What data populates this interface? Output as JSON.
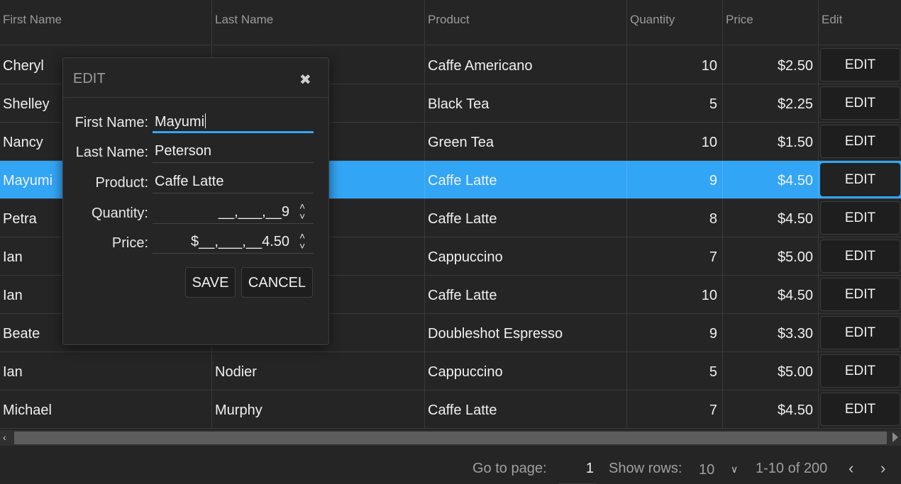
{
  "columns": [
    {
      "label": "First Name"
    },
    {
      "label": "Last Name"
    },
    {
      "label": "Product"
    },
    {
      "label": "Quantity"
    },
    {
      "label": "Price"
    },
    {
      "label": "Edit"
    }
  ],
  "rows": [
    {
      "first": "Cheryl",
      "last": "",
      "product": "Caffe Americano",
      "quantity": "10",
      "price": "$2.50",
      "edit": "EDIT"
    },
    {
      "first": "Shelley",
      "last": "",
      "product": "Black Tea",
      "quantity": "5",
      "price": "$2.25",
      "edit": "EDIT"
    },
    {
      "first": "Nancy",
      "last": "",
      "product": "Green Tea",
      "quantity": "10",
      "price": "$1.50",
      "edit": "EDIT"
    },
    {
      "first": "Mayumi",
      "last": "",
      "product": "Caffe Latte",
      "quantity": "9",
      "price": "$4.50",
      "edit": "EDIT"
    },
    {
      "first": "Petra",
      "last": "",
      "product": "Caffe Latte",
      "quantity": "8",
      "price": "$4.50",
      "edit": "EDIT"
    },
    {
      "first": "Ian",
      "last": "",
      "product": "Cappuccino",
      "quantity": "7",
      "price": "$5.00",
      "edit": "EDIT"
    },
    {
      "first": "Ian",
      "last": "",
      "product": "Caffe Latte",
      "quantity": "10",
      "price": "$4.50",
      "edit": "EDIT"
    },
    {
      "first": "Beate",
      "last": "",
      "product": "Doubleshot Espresso",
      "quantity": "9",
      "price": "$3.30",
      "edit": "EDIT"
    },
    {
      "first": "Ian",
      "last": "Nodier",
      "product": "Cappuccino",
      "quantity": "5",
      "price": "$5.00",
      "edit": "EDIT"
    },
    {
      "first": "Michael",
      "last": "Murphy",
      "product": "Caffe Latte",
      "quantity": "7",
      "price": "$4.50",
      "edit": "EDIT"
    }
  ],
  "selected_row_index": 3,
  "colors": {
    "selection": "#33a5f5",
    "background": "#252525"
  },
  "pager": {
    "go_to_label": "Go to page:",
    "page_value": "1",
    "show_rows_label": "Show rows:",
    "rows_value": "10",
    "range_text": "1-10 of 200"
  },
  "dialog": {
    "title": "EDIT",
    "fields": {
      "first_name": {
        "label": "First Name:",
        "value": "Mayumi"
      },
      "last_name": {
        "label": "Last Name:",
        "value": "Peterson"
      },
      "product": {
        "label": "Product:",
        "value": "Caffe Latte"
      },
      "quantity": {
        "label": "Quantity:",
        "value": "__,___,__9"
      },
      "price": {
        "label": "Price:",
        "value": "$__,___,__4.50"
      }
    },
    "save_label": "SAVE",
    "cancel_label": "CANCEL"
  },
  "icons": {
    "close": "close-icon",
    "spinner_up": "chevron-up-icon",
    "spinner_down": "chevron-down-icon",
    "dropdown": "chevron-down-icon",
    "prev": "chevron-left-icon",
    "next": "chevron-right-icon"
  }
}
